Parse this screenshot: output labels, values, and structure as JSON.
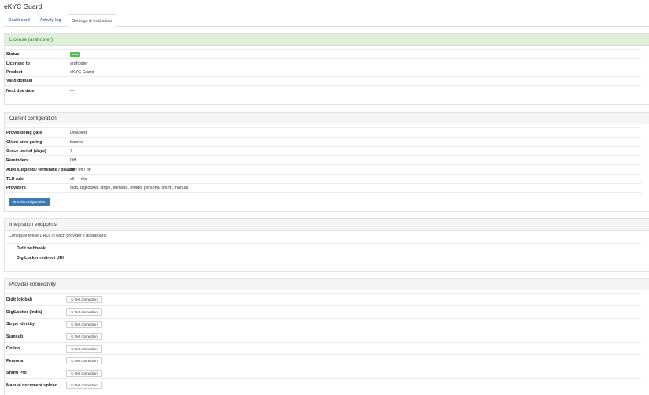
{
  "app": {
    "title": "eKYC Guard"
  },
  "tabs": [
    {
      "label": "Dashboard",
      "active": false
    },
    {
      "label": "Activity log",
      "active": false
    },
    {
      "label": "Settings & endpoints",
      "active": true
    }
  ],
  "license": {
    "heading": "License (arahoster)",
    "rows": [
      {
        "label": "Status",
        "badge": "Active"
      },
      {
        "label": "Licensed to",
        "value": "arahoster"
      },
      {
        "label": "Product",
        "value": "eKYC Guard"
      },
      {
        "label": "Valid domain",
        "value": ""
      },
      {
        "label": "Next due date",
        "value": "—"
      }
    ],
    "badge_color": "#5cb85c"
  },
  "configuration": {
    "heading": "Current configuration",
    "rows": [
      {
        "label": "Provisioning gate",
        "value": "Disabled"
      },
      {
        "label": "Client-area gating",
        "value": "banner"
      },
      {
        "label": "Grace period (days)",
        "value": "7"
      },
      {
        "label": "Reminders",
        "value": "Off"
      },
      {
        "label": "Auto suspend / terminate / disable",
        "value": "off / off / off"
      },
      {
        "label": "TLD rule",
        "value": "all — n/a"
      },
      {
        "label": "Providers",
        "value": "didit, digilocker, stripe, sumsub, onfido, persona, shufti, manual"
      }
    ],
    "edit_button": {
      "icon": "gear-icon",
      "label": "Edit configuration"
    }
  },
  "integration": {
    "heading": "Integration endpoints",
    "note": "Configure these URLs in each provider's dashboard:",
    "rows": [
      {
        "label": "Didit webhook",
        "value": ""
      },
      {
        "label": "DigiLocker redirect URI",
        "value": ""
      }
    ]
  },
  "connectivity": {
    "heading": "Provider connectivity",
    "button_label": "Test connection",
    "button_icon": "plug-icon",
    "providers": [
      {
        "label": "Didit (global)"
      },
      {
        "label": "DigiLocker (India)"
      },
      {
        "label": "Stripe Identity"
      },
      {
        "label": "Sumsub"
      },
      {
        "label": "Onfido"
      },
      {
        "label": "Persona"
      },
      {
        "label": "Shufti Pro"
      },
      {
        "label": "Manual document upload"
      }
    ]
  },
  "colors": {
    "primary": "#3c78b4",
    "success_bg": "#dff0d8",
    "success_text": "#3c763d"
  }
}
